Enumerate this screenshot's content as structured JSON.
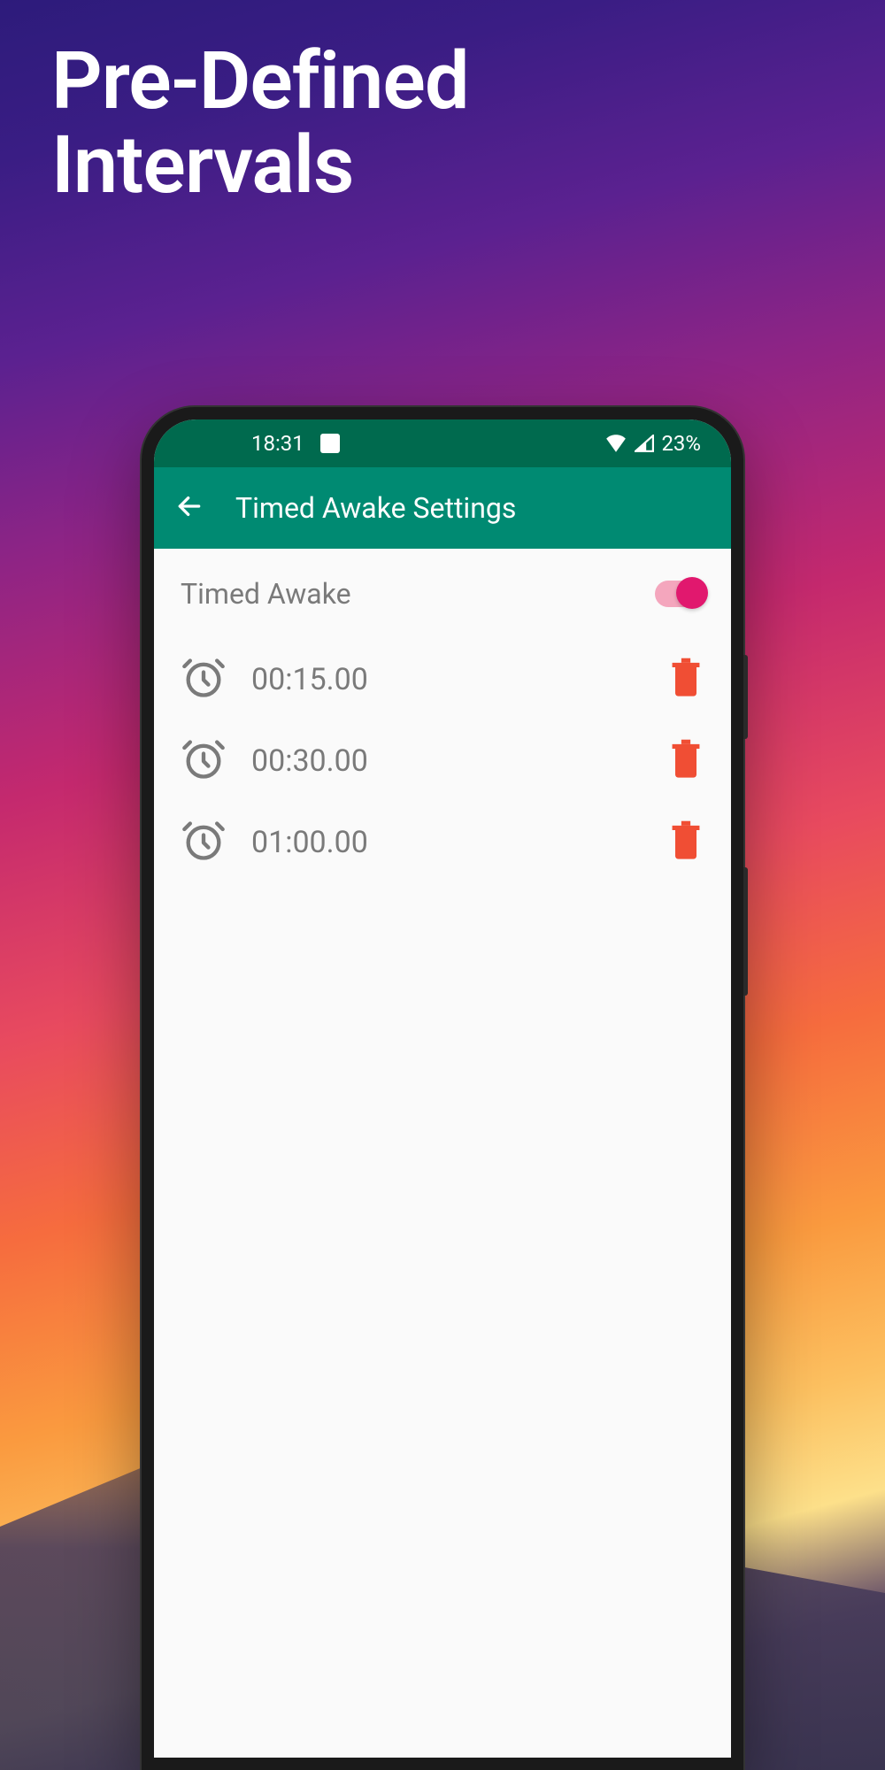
{
  "promo": {
    "headline_line1": "Pre-Defined",
    "headline_line2": "Intervals"
  },
  "statusBar": {
    "time": "18:31",
    "battery": "23%"
  },
  "appBar": {
    "title": "Timed Awake Settings"
  },
  "settings": {
    "toggle_label": "Timed Awake",
    "toggle_on": true
  },
  "intervals": [
    {
      "time": "00:15.00"
    },
    {
      "time": "00:30.00"
    },
    {
      "time": "01:00.00"
    }
  ],
  "colors": {
    "status_bar": "#006a4e",
    "app_bar": "#008a72",
    "accent": "#e1186e",
    "delete": "#f04e34"
  }
}
